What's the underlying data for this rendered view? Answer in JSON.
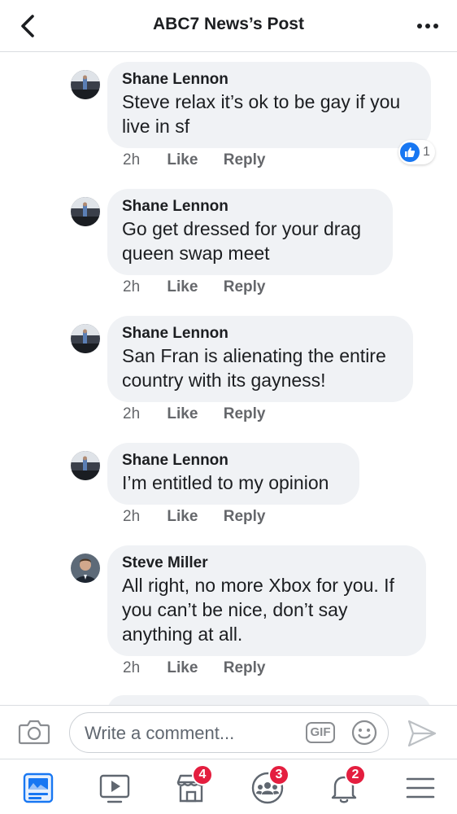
{
  "header": {
    "title": "ABC7 News’s Post"
  },
  "comments": [
    {
      "author": "Shane Lennon",
      "text": "Steve relax it’s ok to be gay if you\nlive in sf",
      "time": "2h",
      "like_label": "Like",
      "reply_label": "Reply",
      "reaction_count": "1"
    },
    {
      "author": "Shane Lennon",
      "text": "Go get dressed for your drag\nqueen swap meet",
      "time": "2h",
      "like_label": "Like",
      "reply_label": "Reply"
    },
    {
      "author": "Shane Lennon",
      "text": "San Fran is alienating the entire\ncountry with its gayness!",
      "time": "2h",
      "like_label": "Like",
      "reply_label": "Reply"
    },
    {
      "author": "Shane Lennon",
      "text": "I’m entitled to my opinion",
      "time": "2h",
      "like_label": "Like",
      "reply_label": "Reply"
    },
    {
      "author": "Steve Miller",
      "text": "All right, no more Xbox for you. If\nyou can’t be nice, don’t say\nanything at all.",
      "time": "2h",
      "like_label": "Like",
      "reply_label": "Reply"
    }
  ],
  "composer": {
    "placeholder": "Write a comment...",
    "gif_label": "GIF"
  },
  "tabbar": {
    "marketplace_badge": "4",
    "groups_badge": "3",
    "notifications_badge": "2"
  },
  "colors": {
    "accent": "#1877f2",
    "badge": "#e41e3f",
    "bubble": "#f0f2f5"
  }
}
